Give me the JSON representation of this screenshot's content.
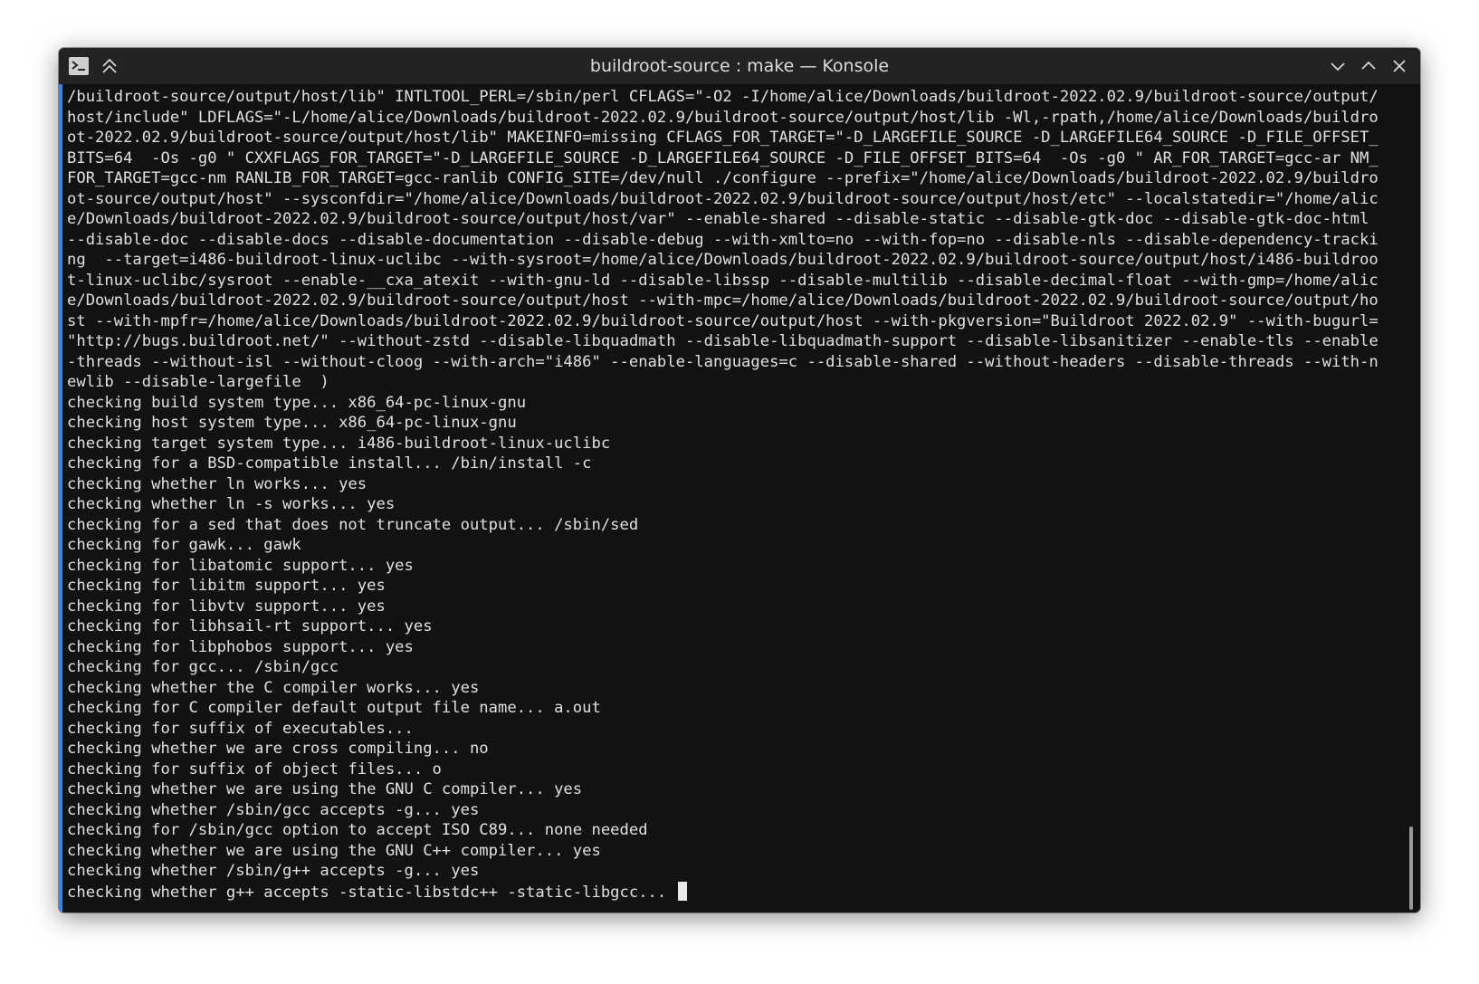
{
  "window": {
    "title": "buildroot-source : make — Konsole"
  },
  "icons": {
    "app": "terminal-icon",
    "keep_above": "double-chevron-up-icon",
    "minimize": "chevron-down-icon",
    "maximize": "chevron-up-icon",
    "close": "close-icon"
  },
  "colors": {
    "accent": "#3b82f6",
    "background": "#121212",
    "titlebar": "#232323",
    "text": "#e0e0e0"
  },
  "terminal": {
    "lines": [
      "/buildroot-source/output/host/lib\" INTLTOOL_PERL=/sbin/perl CFLAGS=\"-O2 -I/home/alice/Downloads/buildroot-2022.02.9/buildroot-source/output/",
      "host/include\" LDFLAGS=\"-L/home/alice/Downloads/buildroot-2022.02.9/buildroot-source/output/host/lib -Wl,-rpath,/home/alice/Downloads/buildro",
      "ot-2022.02.9/buildroot-source/output/host/lib\" MAKEINFO=missing CFLAGS_FOR_TARGET=\"-D_LARGEFILE_SOURCE -D_LARGEFILE64_SOURCE -D_FILE_OFFSET_",
      "BITS=64  -Os -g0 \" CXXFLAGS_FOR_TARGET=\"-D_LARGEFILE_SOURCE -D_LARGEFILE64_SOURCE -D_FILE_OFFSET_BITS=64  -Os -g0 \" AR_FOR_TARGET=gcc-ar NM_",
      "FOR_TARGET=gcc-nm RANLIB_FOR_TARGET=gcc-ranlib CONFIG_SITE=/dev/null ./configure --prefix=\"/home/alice/Downloads/buildroot-2022.02.9/buildro",
      "ot-source/output/host\" --sysconfdir=\"/home/alice/Downloads/buildroot-2022.02.9/buildroot-source/output/host/etc\" --localstatedir=\"/home/alic",
      "e/Downloads/buildroot-2022.02.9/buildroot-source/output/host/var\" --enable-shared --disable-static --disable-gtk-doc --disable-gtk-doc-html",
      "--disable-doc --disable-docs --disable-documentation --disable-debug --with-xmlto=no --with-fop=no --disable-nls --disable-dependency-tracki",
      "ng  --target=i486-buildroot-linux-uclibc --with-sysroot=/home/alice/Downloads/buildroot-2022.02.9/buildroot-source/output/host/i486-buildroo",
      "t-linux-uclibc/sysroot --enable-__cxa_atexit --with-gnu-ld --disable-libssp --disable-multilib --disable-decimal-float --with-gmp=/home/alic",
      "e/Downloads/buildroot-2022.02.9/buildroot-source/output/host --with-mpc=/home/alice/Downloads/buildroot-2022.02.9/buildroot-source/output/ho",
      "st --with-mpfr=/home/alice/Downloads/buildroot-2022.02.9/buildroot-source/output/host --with-pkgversion=\"Buildroot 2022.02.9\" --with-bugurl=",
      "\"http://bugs.buildroot.net/\" --without-zstd --disable-libquadmath --disable-libquadmath-support --disable-libsanitizer --enable-tls --enable",
      "-threads --without-isl --without-cloog --with-arch=\"i486\" --enable-languages=c --disable-shared --without-headers --disable-threads --with-n",
      "ewlib --disable-largefile  )",
      "checking build system type... x86_64-pc-linux-gnu",
      "checking host system type... x86_64-pc-linux-gnu",
      "checking target system type... i486-buildroot-linux-uclibc",
      "checking for a BSD-compatible install... /bin/install -c",
      "checking whether ln works... yes",
      "checking whether ln -s works... yes",
      "checking for a sed that does not truncate output... /sbin/sed",
      "checking for gawk... gawk",
      "checking for libatomic support... yes",
      "checking for libitm support... yes",
      "checking for libvtv support... yes",
      "checking for libhsail-rt support... yes",
      "checking for libphobos support... yes",
      "checking for gcc... /sbin/gcc",
      "checking whether the C compiler works... yes",
      "checking for C compiler default output file name... a.out",
      "checking for suffix of executables...",
      "checking whether we are cross compiling... no",
      "checking for suffix of object files... o",
      "checking whether we are using the GNU C compiler... yes",
      "checking whether /sbin/gcc accepts -g... yes",
      "checking for /sbin/gcc option to accept ISO C89... none needed",
      "checking whether we are using the GNU C++ compiler... yes",
      "checking whether /sbin/g++ accepts -g... yes"
    ],
    "last_line": "checking whether g++ accepts -static-libstdc++ -static-libgcc... "
  }
}
